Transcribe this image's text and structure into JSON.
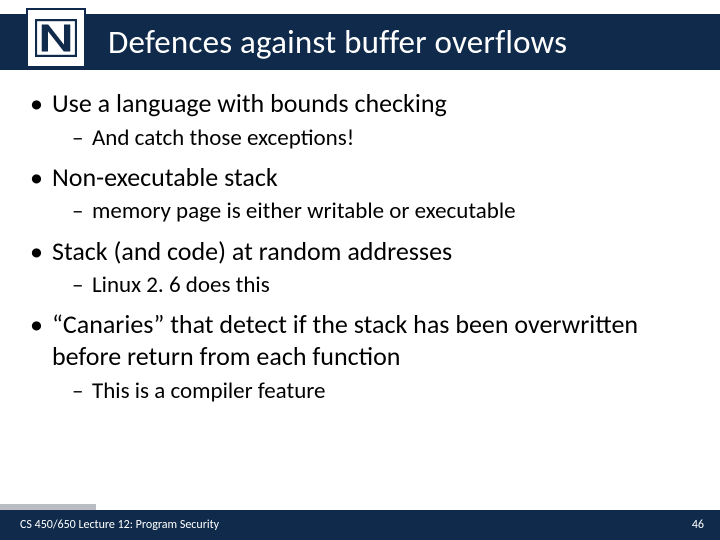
{
  "title": "Defences against buffer overflows",
  "logo_letter": "N",
  "bullets": [
    {
      "l1": "Use a language with bounds checking",
      "l2": "And catch those exceptions!"
    },
    {
      "l1": "Non-executable stack",
      "l2": "memory page is either writable or executable"
    },
    {
      "l1": "Stack (and code) at random addresses",
      "l2": "Linux 2. 6 does this"
    },
    {
      "l1": "“Canaries” that detect if the stack has been overwritten before return from each function",
      "l2": "This is a compiler feature"
    }
  ],
  "footer": {
    "left": "CS 450/650 Lecture 12: Program Security",
    "right": "46"
  },
  "colors": {
    "bar": "#0f2a4a",
    "accent": "#b9bdc2"
  }
}
